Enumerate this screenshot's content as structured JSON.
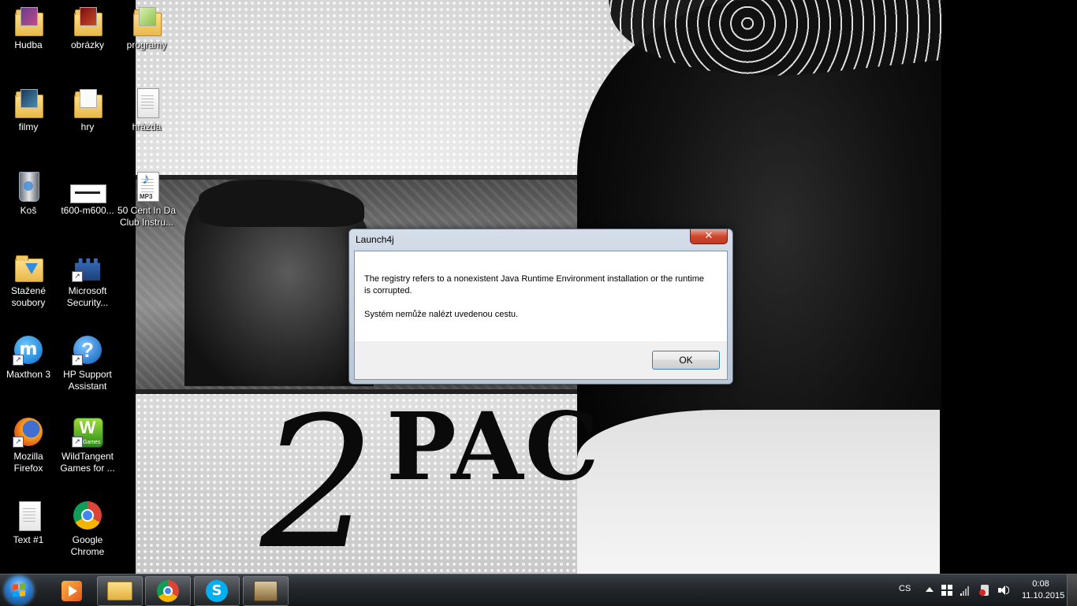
{
  "desktop": {
    "icons": [
      {
        "label": "Hudba"
      },
      {
        "label": "obrázky"
      },
      {
        "label": "programy"
      },
      {
        "label": "filmy"
      },
      {
        "label": "hry"
      },
      {
        "label": "hrázda"
      },
      {
        "label": "Koš"
      },
      {
        "label": "t600-m600..."
      },
      {
        "label": "50 Cent In Da Club Instru..."
      },
      {
        "label": "Stažené soubory"
      },
      {
        "label": "Microsoft Security..."
      },
      {
        "label": "Maxthon 3"
      },
      {
        "label": "HP Support Assistant"
      },
      {
        "label": "Mozilla Firefox"
      },
      {
        "label": "WildTangent Games for ..."
      },
      {
        "label": "Text #1"
      },
      {
        "label": "Google Chrome"
      }
    ],
    "mp3_badge": "MP3",
    "games_badge": "Games"
  },
  "wallpaper": {
    "logo_2": "2",
    "logo_pac": "PAC"
  },
  "dialog": {
    "title": "Launch4j",
    "close_label": "✕",
    "message_line1": "The registry refers to a nonexistent Java Runtime Environment installation or the runtime is corrupted.",
    "message_line2": "Systém nemůže nalézt uvedenou cestu.",
    "ok_label": "OK"
  },
  "taskbar": {
    "language": "CS",
    "time": "0:08",
    "date": "11.10.2015"
  },
  "colors": {
    "taskbar": "#23272b",
    "dialog_frame": "#b9c6d6",
    "close_red": "#c13a22",
    "ok_border": "#3c7fb1"
  }
}
